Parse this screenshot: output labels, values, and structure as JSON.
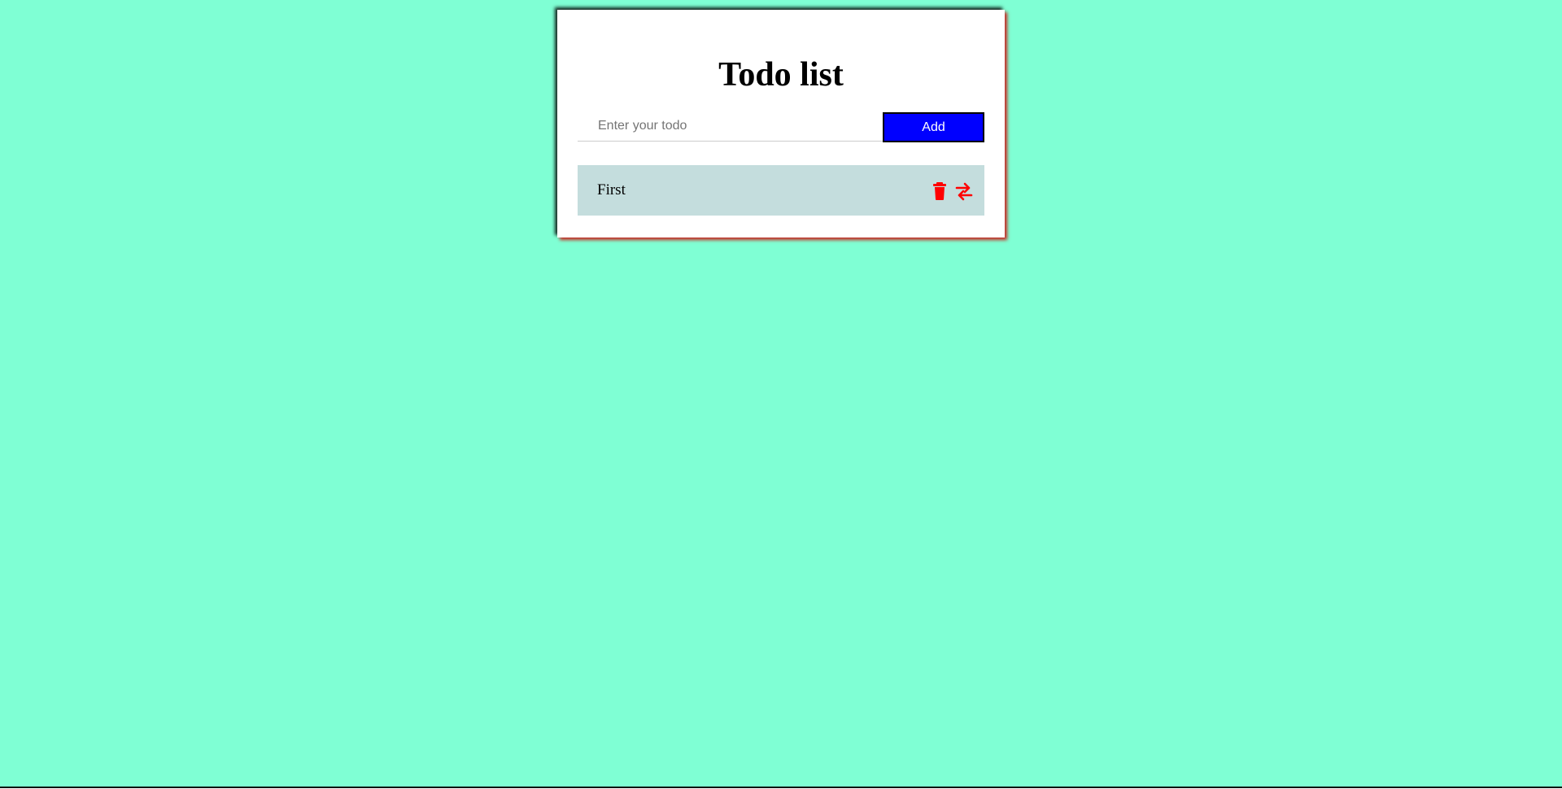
{
  "app": {
    "title": "Todo list"
  },
  "form": {
    "input_placeholder": "Enter your todo",
    "input_value": "",
    "add_label": "Add"
  },
  "todos": [
    {
      "text": "First",
      "actions": [
        {
          "icon": "trash-icon"
        },
        {
          "icon": "swap-arrows-icon"
        }
      ]
    }
  ],
  "colors": {
    "page_background": "#7fffd4",
    "card_background": "#ffffff",
    "add_button": "#0000ff",
    "todo_item_background": "#c4dddd",
    "icon_color": "#ff0000"
  }
}
